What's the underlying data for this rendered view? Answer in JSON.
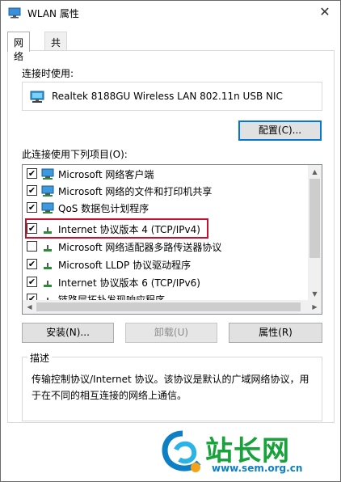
{
  "window": {
    "title": "WLAN 属性"
  },
  "tabs": [
    {
      "label": "网络"
    },
    {
      "label": "共享"
    }
  ],
  "connect_using": {
    "label": "连接时使用:",
    "adapter": "Realtek 8188GU Wireless LAN 802.11n USB NIC"
  },
  "configure_button": "配置(C)...",
  "items_label": "此连接使用下列项目(O):",
  "items": [
    {
      "label": "Microsoft 网络客户端",
      "checked": true,
      "icon": "network-client-icon"
    },
    {
      "label": "Microsoft 网络的文件和打印机共享",
      "checked": true,
      "icon": "network-client-icon"
    },
    {
      "label": "QoS 数据包计划程序",
      "checked": true,
      "icon": "network-client-icon"
    },
    {
      "label": "Internet 协议版本 4 (TCP/IPv4)",
      "checked": true,
      "icon": "protocol-icon"
    },
    {
      "label": "Microsoft 网络适配器多路传送器协议",
      "checked": false,
      "icon": "protocol-icon"
    },
    {
      "label": "Microsoft LLDP 协议驱动程序",
      "checked": true,
      "icon": "protocol-icon"
    },
    {
      "label": "Internet 协议版本 6 (TCP/IPv6)",
      "checked": true,
      "icon": "protocol-icon"
    },
    {
      "label": "链路层拓扑发现响应程序",
      "checked": true,
      "icon": "protocol-icon"
    }
  ],
  "buttons": {
    "install": "安装(N)...",
    "uninstall": "卸载(U)",
    "properties": "属性(R)"
  },
  "description": {
    "label": "描述",
    "text": "传输控制协议/Internet 协议。该协议是默认的广域网络协议，用于在不同的相互连接的网络上通信。"
  },
  "watermark": {
    "text": "站长网",
    "url": "www.sem.org.cn"
  },
  "colors": {
    "highlight_border": "#c8102e",
    "default_button_border": "#0078d7",
    "watermark_green": "#18a23b",
    "watermark_blue": "#0d7fc4"
  }
}
